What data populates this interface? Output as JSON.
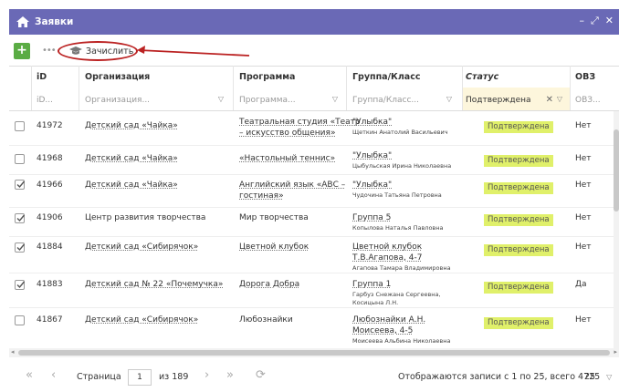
{
  "window": {
    "title": "Заявки",
    "controls": [
      "–",
      "⤢",
      "✕"
    ]
  },
  "toolbar": {
    "add_label": "+",
    "more_label": "•••",
    "enroll_label": "Зачислить"
  },
  "columns": [
    {
      "key": "id",
      "label": "iD",
      "filter": "iD..."
    },
    {
      "key": "org",
      "label": "Организация",
      "filter": "Организация..."
    },
    {
      "key": "program",
      "label": "Программа",
      "filter": "Программа..."
    },
    {
      "key": "group",
      "label": "Группа/Класс",
      "filter": "Группа/Класс..."
    },
    {
      "key": "status",
      "label": "Статус",
      "filter": "Подтверждена"
    },
    {
      "key": "ovz",
      "label": "ОВЗ",
      "filter": "ОВЗ..."
    }
  ],
  "rows": [
    {
      "checked": false,
      "id": "41972",
      "org": "Детский сад «Чайка»",
      "program": [
        "Театральная студия «Театр",
        "– искусство общения»"
      ],
      "group": [
        "\"Улыбка\""
      ],
      "teacher": "Щеткин Анатолий Васильевич",
      "status": "Подтверждена",
      "ovz": "Нет"
    },
    {
      "checked": false,
      "id": "41968",
      "org": "Детский сад «Чайка»",
      "program": [
        "«Настольный теннис»"
      ],
      "group": [
        "\"Улыбка\""
      ],
      "teacher": "Цыбульская Ирина Николаевна",
      "status": "Подтверждена",
      "ovz": "Нет"
    },
    {
      "checked": true,
      "id": "41966",
      "org": "Детский сад «Чайка»",
      "program": [
        "Английский язык «АВС –",
        "гостиная»"
      ],
      "group": [
        "\"Улыбка\""
      ],
      "teacher": "Чудочина Татьяна Петровна",
      "status": "Подтверждена",
      "ovz": "Нет"
    },
    {
      "checked": true,
      "id": "41906",
      "org": "Центр развития творчества",
      "program": [
        "Мир творчества"
      ],
      "group": [
        "Группа 5"
      ],
      "teacher": "Копылова Наталья Павловна",
      "status": "Подтверждена",
      "ovz": "Нет"
    },
    {
      "checked": true,
      "id": "41884",
      "org": "Детский сад «Сибирячок»",
      "program": [
        "Цветной клубок"
      ],
      "group": [
        "Цветной клубок",
        "Т.В.Агапова, 4-7"
      ],
      "teacher": "Агапова Тамара Владимировна",
      "status": "Подтверждена",
      "ovz": "Нет"
    },
    {
      "checked": true,
      "id": "41883",
      "org": "Детский сад № 22 «Почемучка»",
      "program": [
        "Дорога Добра"
      ],
      "group": [
        "Группа 1"
      ],
      "teacher": "Гарбуз Снежана Сергеевна, Косицына Л.Н.",
      "status": "Подтверждена",
      "ovz": "Да"
    },
    {
      "checked": false,
      "id": "41867",
      "org": "Детский сад «Сибирячок»",
      "program": [
        "Любознайки"
      ],
      "group": [
        "Любознайки А.Н.",
        "Моисеева, 4-5"
      ],
      "teacher": "Моисеева Альбина Николаевна",
      "status": "Подтверждена",
      "ovz": "Нет"
    }
  ],
  "pager": {
    "first": "«",
    "prev": "‹",
    "page_label": "Страница",
    "page": "1",
    "of_label": "из 189",
    "next": "›",
    "last": "»",
    "refresh": "⟳",
    "info": "Отображаются записи с 1 по 25, всего 4725",
    "page_size": "25"
  }
}
